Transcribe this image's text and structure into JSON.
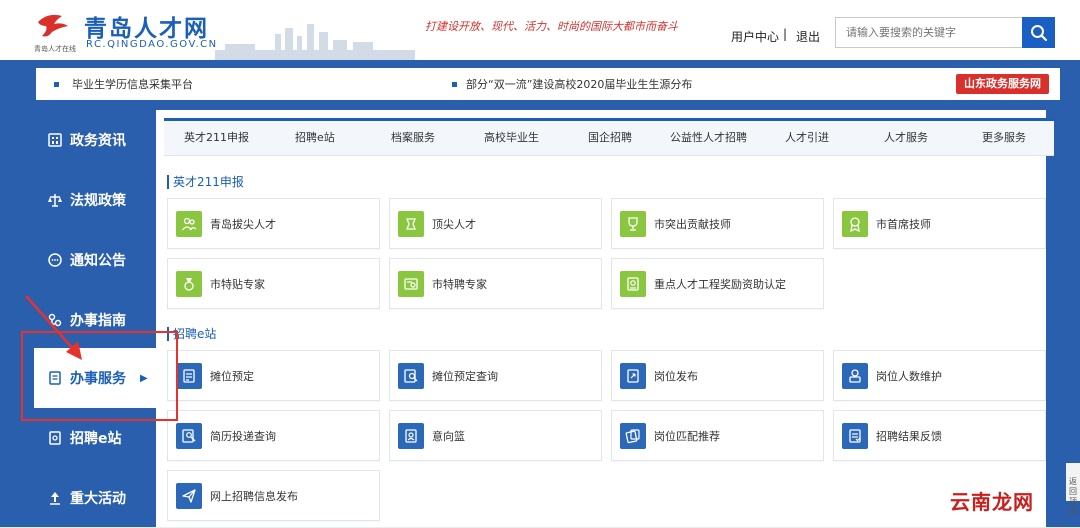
{
  "header": {
    "site_title": "青岛人才网",
    "site_url": "RC.QINGDAO.GOV.CN",
    "logo_sub": "青岛人才在线",
    "slogan": "打建设开放、现代、活力、时尚的国际大都市而奋斗",
    "user_center": "用户中心",
    "separator": "|",
    "logout": "退出",
    "search_placeholder": "请输入要搜索的关键字"
  },
  "notice": {
    "item1": "毕业生学历信息采集平台",
    "item2": "部分“双一流”建设高校2020届毕业生生源分布",
    "badge": "山东政务服务网"
  },
  "sidebar": {
    "items": [
      {
        "label": "政务资讯",
        "icon": "building-icon"
      },
      {
        "label": "法规政策",
        "icon": "scales-icon"
      },
      {
        "label": "通知公告",
        "icon": "chat-icon"
      },
      {
        "label": "办事指南",
        "icon": "guide-icon"
      },
      {
        "label": "办事服务",
        "icon": "document-icon",
        "active": true
      },
      {
        "label": "招聘e站",
        "icon": "recruit-icon"
      },
      {
        "label": "重大活动",
        "icon": "flag-icon"
      }
    ]
  },
  "tabs": [
    "英才211申报",
    "招聘e站",
    "档案服务",
    "高校毕业生",
    "国企招聘",
    "公益性人才招聘",
    "人才引进",
    "人才服务",
    "更多服务"
  ],
  "sections": [
    {
      "title": "英才211申报",
      "cards": [
        {
          "label": "青岛拔尖人才",
          "icon": "people-icon",
          "color": "green"
        },
        {
          "label": "顶尖人才",
          "icon": "star-icon",
          "color": "green"
        },
        {
          "label": "市突出贡献技师",
          "icon": "trophy-icon",
          "color": "green"
        },
        {
          "label": "市首席技师",
          "icon": "medal-icon",
          "color": "green"
        },
        {
          "label": "市特贴专家",
          "icon": "award-icon",
          "color": "green"
        },
        {
          "label": "市特聘专家",
          "icon": "certificate-icon",
          "color": "green"
        },
        {
          "label": "重点人才工程奖励资助认定",
          "icon": "badge-icon",
          "color": "green"
        }
      ]
    },
    {
      "title": "招聘e站",
      "cards": [
        {
          "label": "摊位预定",
          "icon": "form-icon",
          "color": "blue"
        },
        {
          "label": "摊位预定查询",
          "icon": "search-doc-icon",
          "color": "blue"
        },
        {
          "label": "岗位发布",
          "icon": "publish-icon",
          "color": "blue"
        },
        {
          "label": "岗位人数维护",
          "icon": "people-maintain-icon",
          "color": "blue"
        },
        {
          "label": "简历投递查询",
          "icon": "resume-search-icon",
          "color": "blue"
        },
        {
          "label": "意向篮",
          "icon": "basket-icon",
          "color": "blue"
        },
        {
          "label": "岗位匹配推荐",
          "icon": "match-icon",
          "color": "blue"
        },
        {
          "label": "招聘结果反馈",
          "icon": "feedback-icon",
          "color": "blue"
        },
        {
          "label": "网上招聘信息发布",
          "icon": "send-icon",
          "color": "blue"
        }
      ]
    }
  ],
  "back_top": "返回顶部",
  "watermark": "云南龙网",
  "colors": {
    "primary": "#1b5fb8",
    "sidebar_bg": "#2a5fae",
    "green": "#8ac63f",
    "blue": "#2b68b8",
    "red": "#e5322d"
  }
}
